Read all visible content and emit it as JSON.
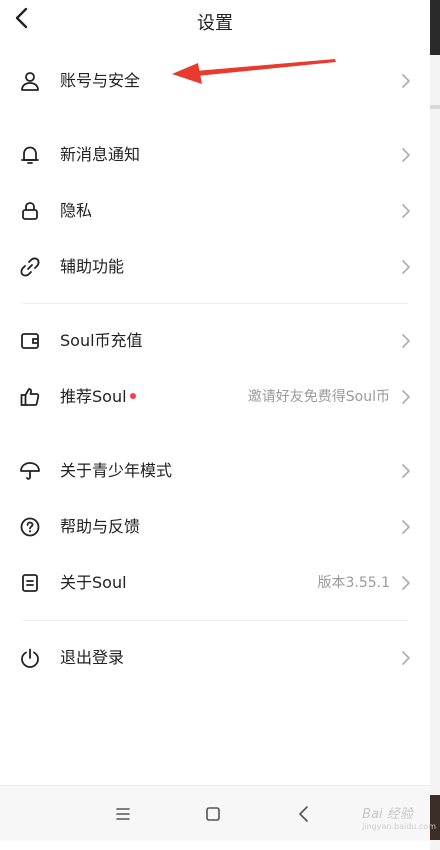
{
  "header": {
    "title": "设置"
  },
  "groups": {
    "account": {
      "label": "账号与安全"
    },
    "notify": {
      "label": "新消息通知"
    },
    "privacy": {
      "label": "隐私"
    },
    "assist": {
      "label": "辅助功能"
    },
    "recharge": {
      "label": "Soul币充值"
    },
    "recommend": {
      "label": "推荐Soul",
      "value": "邀请好友免费得Soul币"
    },
    "teen": {
      "label": "关于青少年模式"
    },
    "help": {
      "label": "帮助与反馈"
    },
    "about": {
      "label": "关于Soul",
      "value": "版本3.55.1"
    },
    "logout": {
      "label": "退出登录"
    }
  },
  "watermark": {
    "brand": "Bai 经验",
    "site": "jingyan.baidu.com"
  },
  "colors": {
    "accent_red": "#ff3b4e",
    "annotation_arrow": "#e83a2e",
    "text": "#222222",
    "muted": "#9a9a9a"
  }
}
